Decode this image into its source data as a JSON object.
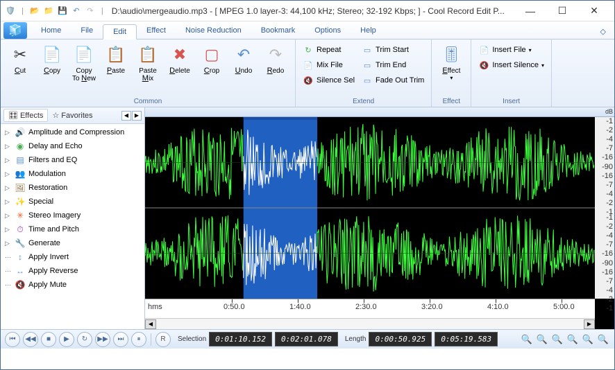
{
  "title": "D:\\audio\\mergeaudio.mp3 - [ MPEG 1.0 layer-3: 44,100 kHz; Stereo; 32-192 Kbps;  ] - Cool Record Edit P...",
  "menu": {
    "tabs": [
      "Home",
      "File",
      "Edit",
      "Effect",
      "Noise Reduction",
      "Bookmark",
      "Options",
      "Help"
    ],
    "active": 2
  },
  "ribbon": {
    "groups": [
      {
        "label": "Common",
        "large": [
          {
            "label": "Cut",
            "icon": "✂",
            "color": "#333"
          },
          {
            "label": "Copy",
            "icon": "📄",
            "color": "#5a8fd6"
          },
          {
            "label": "Copy To New",
            "icon": "📄",
            "badge": "+",
            "color": "#5a8fd6"
          },
          {
            "label": "Paste",
            "icon": "📋",
            "color": "#c97b3e"
          },
          {
            "label": "Paste Mix",
            "icon": "📋",
            "color": "#c97b3e"
          },
          {
            "label": "Delete",
            "icon": "✖",
            "color": "#d9534f"
          },
          {
            "label": "Crop",
            "icon": "▢",
            "color": "#d9534f"
          },
          {
            "label": "Undo",
            "icon": "↶",
            "color": "#5a8fd6"
          },
          {
            "label": "Redo",
            "icon": "↷",
            "color": "#bbb"
          }
        ]
      },
      {
        "label": "Extend",
        "small": [
          {
            "label": "Repeat",
            "icon": "↻",
            "color": "#4caf50"
          },
          {
            "label": "Mix File",
            "icon": "📄",
            "color": "#e6a23c"
          },
          {
            "label": "Silence Sel",
            "icon": "🔇",
            "color": "#5a8fd6"
          },
          {
            "label": "Trim Start",
            "icon": "▭",
            "color": "#5a8fd6"
          },
          {
            "label": "Trim End",
            "icon": "▭",
            "color": "#5a8fd6"
          },
          {
            "label": "Fade Out Trim",
            "icon": "▭",
            "color": "#5a8fd6"
          }
        ]
      },
      {
        "label": "Effect",
        "large": [
          {
            "label": "Effect",
            "icon": "🎚",
            "color": "#5a8fd6",
            "dropdown": true
          }
        ]
      },
      {
        "label": "Insert",
        "small": [
          {
            "label": "Insert File",
            "icon": "📄",
            "color": "#e6a23c",
            "dropdown": true
          },
          {
            "label": "Insert Silence",
            "icon": "🔇",
            "color": "#5a8fd6",
            "dropdown": true
          }
        ]
      }
    ]
  },
  "sidebar": {
    "tabs": [
      {
        "label": "Effects",
        "icon": "🎛"
      },
      {
        "label": "Favorites",
        "icon": "☆"
      }
    ],
    "activeTab": 0,
    "tree": [
      {
        "label": "Amplitude and Compression",
        "expandable": true,
        "icon": "🔊",
        "color": "#e6a23c"
      },
      {
        "label": "Delay and Echo",
        "expandable": true,
        "icon": "◉",
        "color": "#4caf50"
      },
      {
        "label": "Filters and EQ",
        "expandable": true,
        "icon": "▤",
        "color": "#5a8fd6"
      },
      {
        "label": "Modulation",
        "expandable": true,
        "icon": "👥",
        "color": "#e6a23c"
      },
      {
        "label": "Restoration",
        "expandable": true,
        "icon": "🖼",
        "color": "#8a6d3b"
      },
      {
        "label": "Special",
        "expandable": true,
        "icon": "✨",
        "color": "#ffc107"
      },
      {
        "label": "Stereo Imagery",
        "expandable": true,
        "icon": "✳",
        "color": "#ff5722"
      },
      {
        "label": "Time and Pitch",
        "expandable": true,
        "icon": "⏱",
        "color": "#9c27b0"
      },
      {
        "label": "Generate",
        "expandable": true,
        "icon": "🔧",
        "color": "#795548"
      },
      {
        "label": "Apply Invert",
        "expandable": false,
        "icon": "↕",
        "color": "#5a8fd6"
      },
      {
        "label": "Apply Reverse",
        "expandable": false,
        "icon": "↔",
        "color": "#5a8fd6"
      },
      {
        "label": "Apply Mute",
        "expandable": false,
        "icon": "🔇",
        "color": "#999"
      }
    ]
  },
  "timeline": {
    "unit": "hms",
    "ticks": [
      "0:50.0",
      "1:40.0",
      "2:30.0",
      "3:20.0",
      "4:10.0",
      "5:00.0"
    ]
  },
  "dbScale": {
    "header": "dB",
    "values": [
      "-1",
      "-2",
      "-4",
      "-7",
      "-16",
      "-90",
      "-16",
      "-7",
      "-4",
      "-2",
      "-1"
    ]
  },
  "selection": {
    "label": "Selection",
    "start": "0:01:10.152",
    "end": "0:02:01.078"
  },
  "length": {
    "label": "Length",
    "sel": "0:00:50.925",
    "total": "0:05:19.583"
  },
  "colors": {
    "waveform": "#3eff3e",
    "selection": "#2060c0",
    "selectionWave": "#ffffff"
  }
}
